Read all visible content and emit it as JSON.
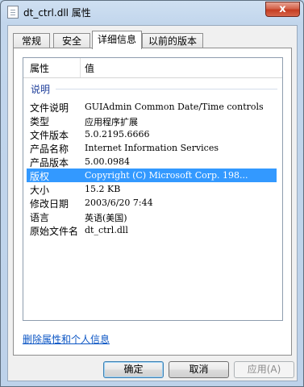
{
  "window": {
    "title": "dt_ctrl.dll 属性",
    "close_glyph": "x"
  },
  "tabs": [
    {
      "label": "常规"
    },
    {
      "label": "安全"
    },
    {
      "label": "详细信息",
      "active": true
    },
    {
      "label": "以前的版本"
    }
  ],
  "list": {
    "headers": {
      "property": "属性",
      "value": "值"
    },
    "group": "说明",
    "rows": [
      {
        "name": "文件说明",
        "value": "GUIAdmin Common Date/Time controls"
      },
      {
        "name": "类型",
        "value": "应用程序扩展"
      },
      {
        "name": "文件版本",
        "value": "5.0.2195.6666"
      },
      {
        "name": "产品名称",
        "value": "Internet Information Services"
      },
      {
        "name": "产品版本",
        "value": "5.00.0984"
      },
      {
        "name": "版权",
        "value": "Copyright (C) Microsoft Corp. 198...",
        "selected": true
      },
      {
        "name": "大小",
        "value": "15.2 KB"
      },
      {
        "name": "修改日期",
        "value": "2003/6/20 7:44"
      },
      {
        "name": "语言",
        "value": "英语(美国)"
      },
      {
        "name": "原始文件名",
        "value": "dt_ctrl.dll"
      }
    ]
  },
  "remove_link": "删除属性和个人信息",
  "buttons": {
    "ok": "确定",
    "cancel": "取消",
    "apply": "应用(A)"
  }
}
